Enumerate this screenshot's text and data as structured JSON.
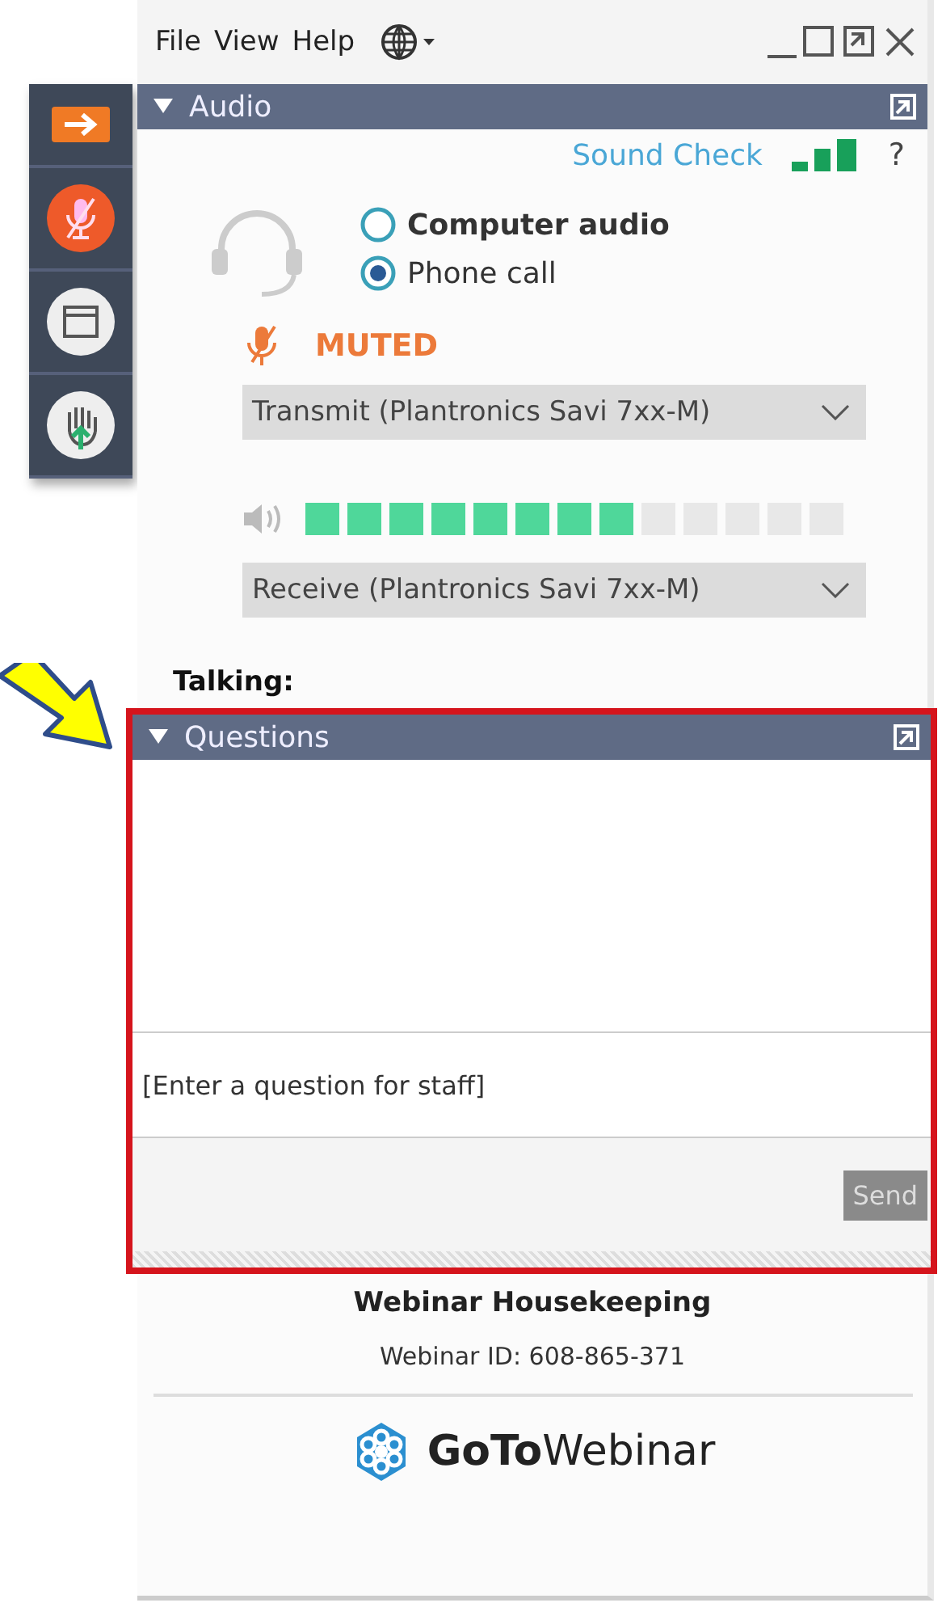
{
  "menu": [
    "File",
    "View",
    "Help"
  ],
  "sidebar": [
    {
      "kind": "arrow"
    },
    {
      "kind": "mic",
      "on": true
    },
    {
      "kind": "window"
    },
    {
      "kind": "hand"
    }
  ],
  "audio": {
    "title": "Audio",
    "expanded": true,
    "sound_check": "Sound Check",
    "help": "?",
    "options": [
      {
        "label": "Computer audio",
        "selected": false
      },
      {
        "label": "Phone call",
        "selected": true
      }
    ],
    "mute_status": "MUTED",
    "transmit": "Transmit (Plantronics Savi 7xx-M)",
    "level": 0.615,
    "receive": "Receive (Plantronics Savi 7xx-M)",
    "talking_label": "Talking:"
  },
  "questions": {
    "title": "Questions",
    "expanded": true,
    "placeholder": "[Enter a question for staff]",
    "send": "Send",
    "send_disabled": true
  },
  "footer": {
    "title": "Webinar Housekeeping",
    "webinar_id": "Webinar ID: 608-865-371",
    "logo": "**GoTo**Webinar"
  }
}
